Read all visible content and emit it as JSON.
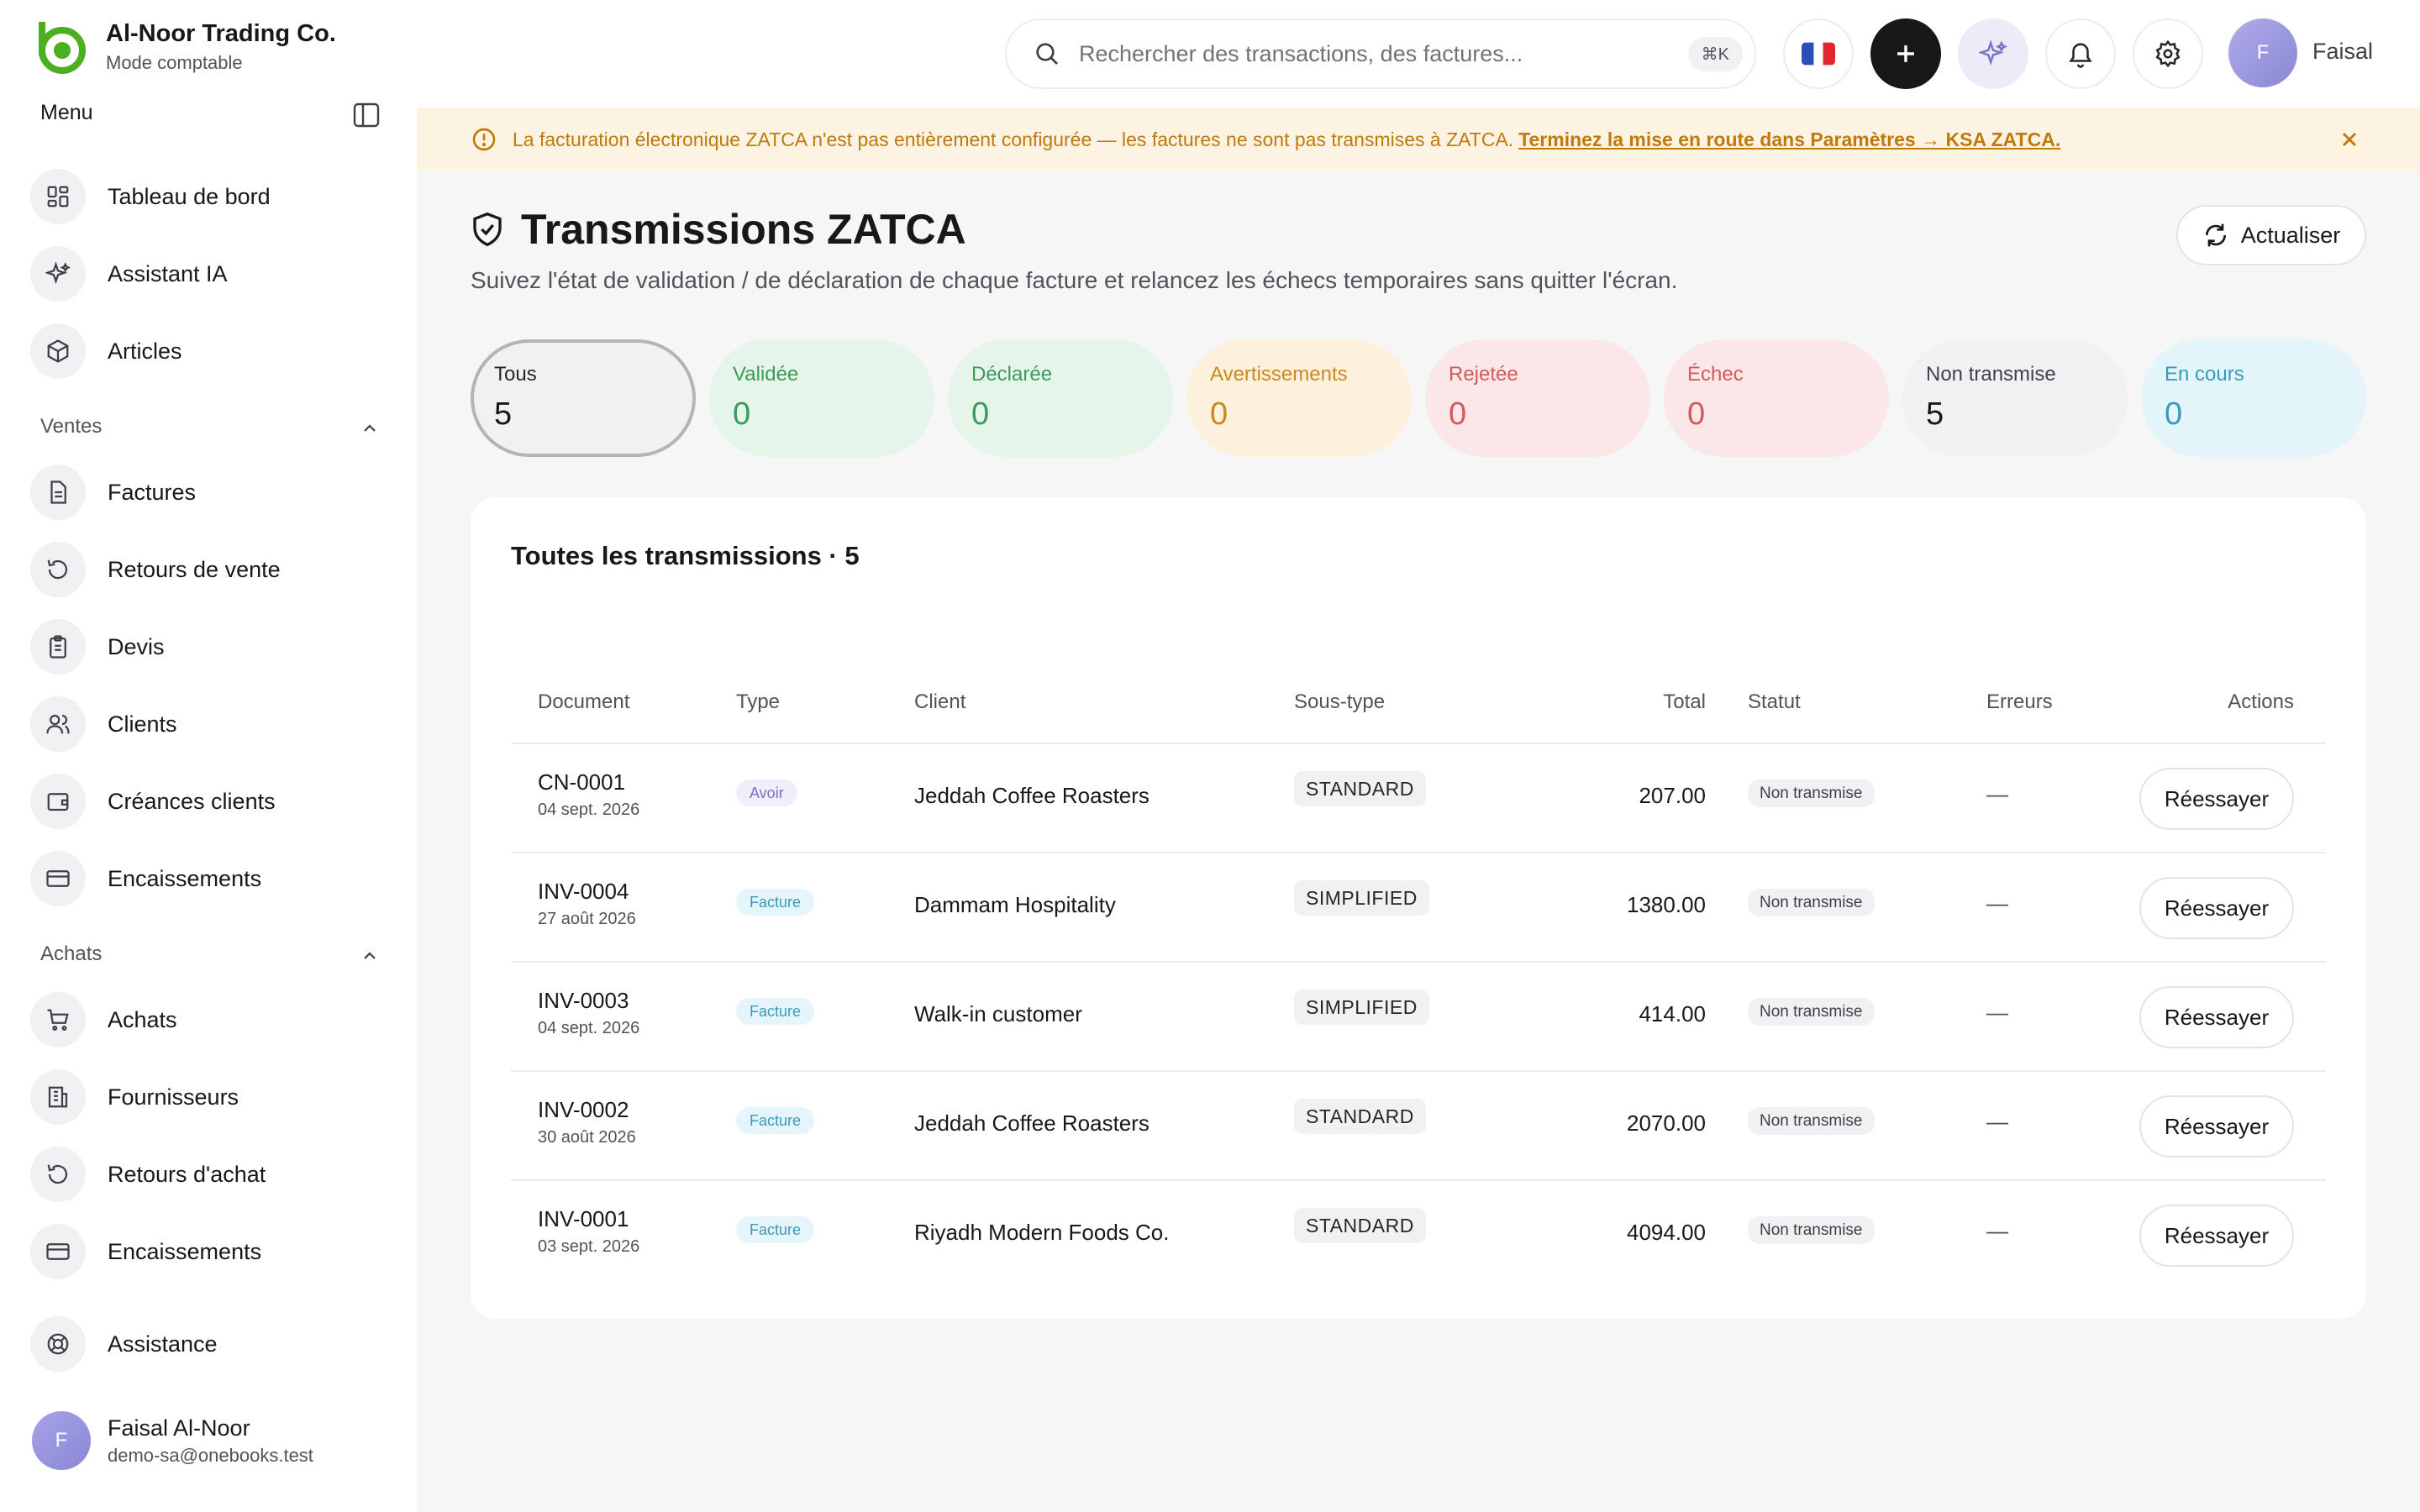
{
  "brand": {
    "name": "Al-Noor Trading Co.",
    "subtitle": "Mode comptable"
  },
  "sidebar": {
    "menu_title": "Menu",
    "top_items": [
      {
        "label": "Tableau de bord",
        "icon": "dashboard-icon"
      },
      {
        "label": "Assistant IA",
        "icon": "sparkles-icon"
      },
      {
        "label": "Articles",
        "icon": "box-icon"
      }
    ],
    "sections": [
      {
        "title": "Ventes",
        "items": [
          {
            "label": "Factures",
            "icon": "invoice-icon"
          },
          {
            "label": "Retours de vente",
            "icon": "return-icon"
          },
          {
            "label": "Devis",
            "icon": "quote-icon"
          },
          {
            "label": "Clients",
            "icon": "users-icon"
          },
          {
            "label": "Créances clients",
            "icon": "wallet-icon"
          },
          {
            "label": "Encaissements",
            "icon": "card-icon"
          }
        ]
      },
      {
        "title": "Achats",
        "items": [
          {
            "label": "Achats",
            "icon": "cart-icon"
          },
          {
            "label": "Fournisseurs",
            "icon": "building-icon"
          },
          {
            "label": "Retours d'achat",
            "icon": "return-icon"
          },
          {
            "label": "Encaissements",
            "icon": "card-icon"
          }
        ]
      }
    ],
    "support": {
      "label": "Assistance",
      "icon": "lifebuoy-icon"
    },
    "user": {
      "initial": "F",
      "name": "Faisal Al-Noor",
      "email": "demo-sa@onebooks.test"
    }
  },
  "topbar": {
    "search_placeholder": "Rechercher des transactions, des factures...",
    "shortcut": "⌘K",
    "profile_initial": "F",
    "profile_name": "Faisal"
  },
  "banner": {
    "text": "La facturation électronique ZATCA n'est pas entièrement configurée — les factures ne sont pas transmises à ZATCA.",
    "link": "Terminez la mise en route dans Paramètres → KSA ZATCA."
  },
  "page": {
    "title": "Transmissions ZATCA",
    "subtitle": "Suivez l'état de validation / de déclaration de chaque facture et relancez les échecs temporaires sans quitter l'écran.",
    "refresh_label": "Actualiser"
  },
  "filters": [
    {
      "label": "Tous",
      "value": "5"
    },
    {
      "label": "Validée",
      "value": "0"
    },
    {
      "label": "Déclarée",
      "value": "0"
    },
    {
      "label": "Avertissements",
      "value": "0"
    },
    {
      "label": "Rejetée",
      "value": "0"
    },
    {
      "label": "Échec",
      "value": "0"
    },
    {
      "label": "Non transmise",
      "value": "5"
    },
    {
      "label": "En cours",
      "value": "0"
    }
  ],
  "table": {
    "title": "Toutes les transmissions · 5",
    "headers": {
      "document": "Document",
      "type": "Type",
      "client": "Client",
      "subtype": "Sous-type",
      "total": "Total",
      "status": "Statut",
      "errors": "Erreurs",
      "actions": "Actions"
    },
    "rows": [
      {
        "doc": "CN-0001",
        "date": "04 sept. 2026",
        "type": "Avoir",
        "client": "Jeddah Coffee Roasters",
        "subtype": "STANDARD",
        "total": "207.00",
        "status": "Non transmise",
        "errors": "—",
        "action": "Réessayer"
      },
      {
        "doc": "INV-0004",
        "date": "27 août 2026",
        "type": "Facture",
        "client": "Dammam Hospitality",
        "subtype": "SIMPLIFIED",
        "total": "1380.00",
        "status": "Non transmise",
        "errors": "—",
        "action": "Réessayer"
      },
      {
        "doc": "INV-0003",
        "date": "04 sept. 2026",
        "type": "Facture",
        "client": "Walk-in customer",
        "subtype": "SIMPLIFIED",
        "total": "414.00",
        "status": "Non transmise",
        "errors": "—",
        "action": "Réessayer"
      },
      {
        "doc": "INV-0002",
        "date": "30 août 2026",
        "type": "Facture",
        "client": "Jeddah Coffee Roasters",
        "subtype": "STANDARD",
        "total": "2070.00",
        "status": "Non transmise",
        "errors": "—",
        "action": "Réessayer"
      },
      {
        "doc": "INV-0001",
        "date": "03 sept. 2026",
        "type": "Facture",
        "client": "Riyadh Modern Foods Co.",
        "subtype": "STANDARD",
        "total": "4094.00",
        "status": "Non transmise",
        "errors": "—",
        "action": "Réessayer"
      }
    ]
  },
  "colors": {
    "brand_green": "#4caf1f",
    "warning_text": "#c2790c",
    "warning_bg": "#fdf3e3"
  }
}
